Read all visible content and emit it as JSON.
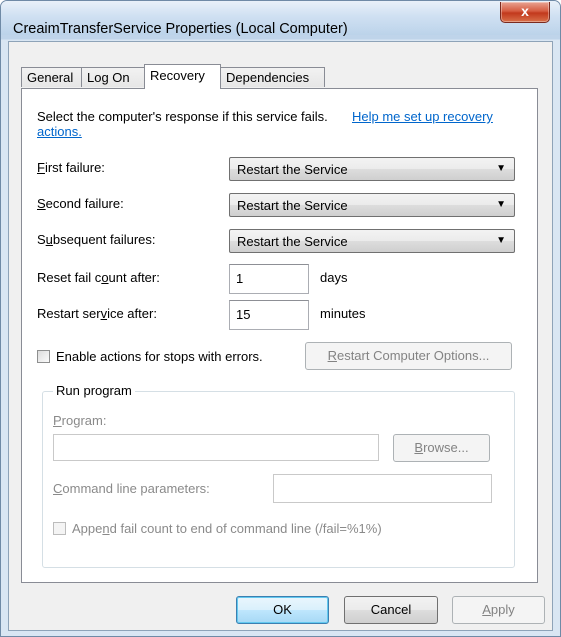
{
  "window": {
    "title": "CreaimTransferService Properties (Local Computer)",
    "close_glyph": "x"
  },
  "tabs": [
    {
      "label": "General"
    },
    {
      "label": "Log On"
    },
    {
      "label": "Recovery"
    },
    {
      "label": "Dependencies"
    }
  ],
  "recovery": {
    "intro_text": "Select the computer's response if this service fails.",
    "help_link_line1": "Help me set up recovery",
    "help_link_line2": "actions.",
    "first_failure": {
      "label_u": "F",
      "label_rest": "irst failure:",
      "value": "Restart the Service"
    },
    "second_failure": {
      "label_u": "S",
      "label_rest": "econd failure:",
      "value": "Restart the Service"
    },
    "subsequent_failures": {
      "label_pre": "S",
      "label_u": "u",
      "label_rest": "bsequent failures:",
      "value": "Restart the Service"
    },
    "reset_fail_count": {
      "label_pre": "Reset fail c",
      "label_u": "o",
      "label_rest": "unt after:",
      "value": "1",
      "unit": "days"
    },
    "restart_service": {
      "label_pre": "Restart ser",
      "label_u": "v",
      "label_rest": "ice after:",
      "value": "15",
      "unit": "minutes"
    },
    "enable_actions_label": "Enable actions for stops with errors.",
    "restart_computer_options": {
      "u": "R",
      "rest": "estart Computer Options..."
    }
  },
  "run_program": {
    "title": "Run program",
    "program_label": {
      "u": "P",
      "rest": "rogram:"
    },
    "program_value": "",
    "browse": {
      "u": "B",
      "rest": "rowse..."
    },
    "command_line_label": {
      "u": "C",
      "rest": "ommand line parameters:"
    },
    "command_line_value": "",
    "append_label": {
      "pre": "Appe",
      "u": "n",
      "rest": "d fail count to end of command line (/fail=%1%)"
    }
  },
  "buttons": {
    "ok": "OK",
    "cancel": "Cancel",
    "apply": {
      "u": "A",
      "rest": "pply"
    }
  }
}
